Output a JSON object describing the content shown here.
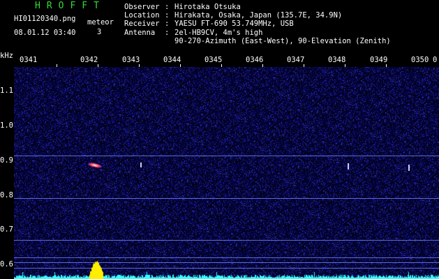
{
  "header": {
    "brand": "HROFFT",
    "filename": "HI01120340.png",
    "timestamp": "08.01.12 03:40",
    "meteor_label": "meteor",
    "meteor_count": "3"
  },
  "station": {
    "observer_label": "Observer",
    "observer": "Hirotaka Otsuka",
    "location_label": "Location",
    "location": "Hirakata, Osaka, Japan (135.7E, 34.9N)",
    "receiver_label": "Receiver",
    "receiver": "YAESU FT-690 53.749MHz, USB",
    "antenna_label": "Antenna",
    "antenna": "2el-HB9CV, 4m's high",
    "antenna_detail": "90-270-Azimuth (East-West), 90-Elevation (Zenith)",
    "separator": ":"
  },
  "spectrogram": {
    "unit": "kHz",
    "time_ticks": [
      "0341",
      "0342",
      "0343",
      "0344",
      "0345",
      "0346",
      "0347",
      "0348",
      "0349",
      "0350"
    ],
    "right_label": "0",
    "freq_ticks": [
      "1.1",
      "1.0",
      "0.9",
      "0.8",
      "0.7",
      "0.6"
    ],
    "colors": {
      "background": "#000018",
      "noise": "#2a2ab0",
      "reference_line": "#5a6ad8",
      "echo": "#ff3344",
      "baseline": "#33ffff",
      "burst": "#ffee00"
    }
  }
}
